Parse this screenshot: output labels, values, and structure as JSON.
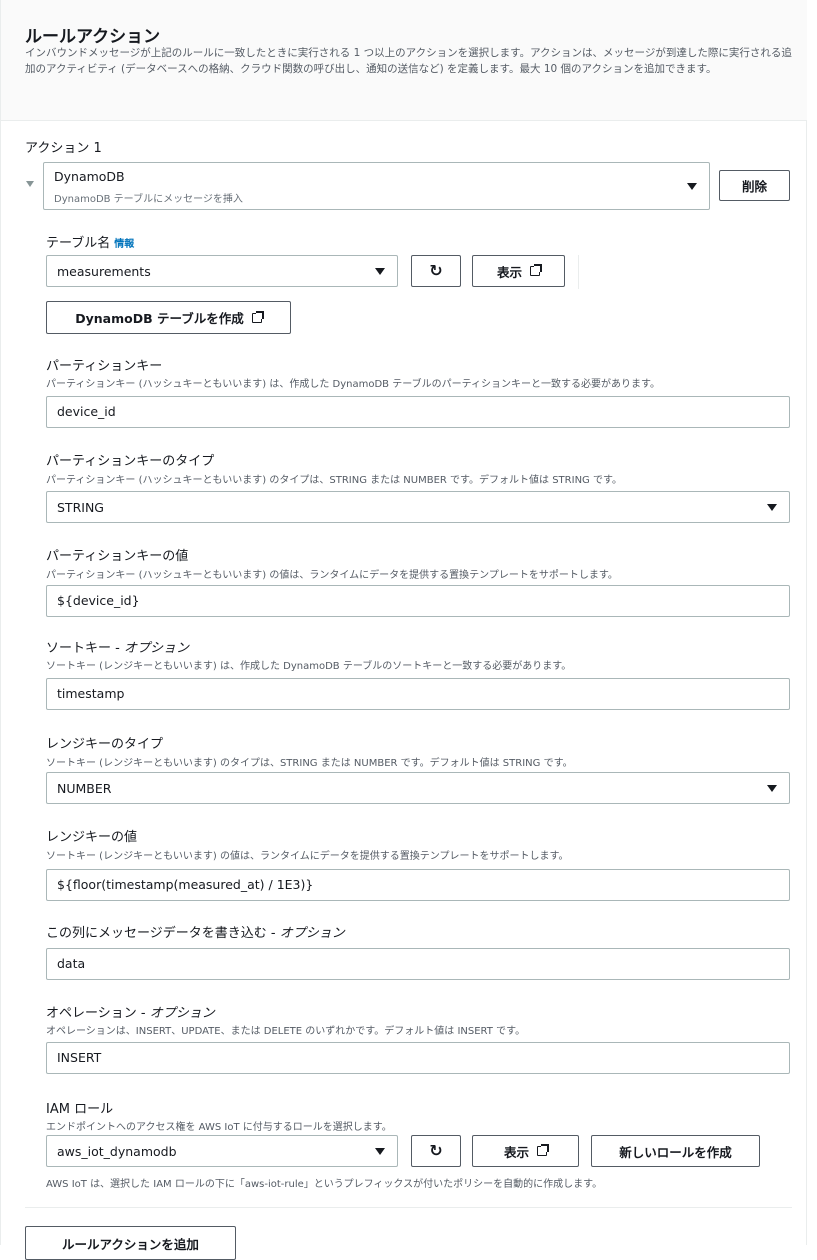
{
  "header": {
    "title": "ルールアクション",
    "description": "インバウンドメッセージが上記のルールに一致したときに実行される 1 つ以上のアクションを選択します。アクションは、メッセージが到達した際に実行される追加のアクティビティ (データベースへの格納、クラウド関数の呼び出し、通知の送信など) を定義します。最大 10 個のアクションを追加できます。"
  },
  "action": {
    "label": "アクション 1",
    "service": "DynamoDB",
    "service_desc": "DynamoDB テーブルにメッセージを挿入",
    "delete_label": "削除"
  },
  "table": {
    "label": "テーブル名",
    "info": "情報",
    "value": "measurements",
    "view_label": "表示",
    "create_label": "DynamoDB テーブルを作成"
  },
  "partition_key": {
    "label": "パーティションキー",
    "desc": "パーティションキー (ハッシュキーともいいます) は、作成した DynamoDB テーブルのパーティションキーと一致する必要があります。",
    "value": "device_id"
  },
  "partition_key_type": {
    "label": "パーティションキーのタイプ",
    "desc": "パーティションキー (ハッシュキーともいいます) のタイプは、STRING または NUMBER です。デフォルト値は STRING です。",
    "value": "STRING"
  },
  "partition_key_value": {
    "label": "パーティションキーの値",
    "desc": "パーティションキー (ハッシュキーともいいます) の値は、ランタイムにデータを提供する置換テンプレートをサポートします。",
    "value": "${device_id}"
  },
  "sort_key": {
    "label": "ソートキー - ",
    "label_opt": "オプション",
    "desc": "ソートキー (レンジキーともいいます) は、作成した DynamoDB テーブルのソートキーと一致する必要があります。",
    "value": "timestamp"
  },
  "range_key_type": {
    "label": "レンジキーのタイプ",
    "desc": "ソートキー (レンジキーともいいます) のタイプは、STRING または NUMBER です。デフォルト値は STRING です。",
    "value": "NUMBER"
  },
  "range_key_value": {
    "label": "レンジキーの値",
    "desc": "ソートキー (レンジキーともいいます) の値は、ランタイムにデータを提供する置換テンプレートをサポートします。",
    "value": "${floor(timestamp(measured_at) / 1E3)}"
  },
  "payload_column": {
    "label": "この列にメッセージデータを書き込む - ",
    "label_opt": "オプション",
    "value": "data"
  },
  "operation": {
    "label": "オペレーション - ",
    "label_opt": "オプション",
    "desc": "オペレーションは、INSERT、UPDATE、または DELETE のいずれかです。デフォルト値は INSERT です。",
    "value": "INSERT"
  },
  "iam_role": {
    "label": "IAM ロール",
    "desc": "エンドポイントへのアクセス権を AWS IoT に付与するロールを選択します。",
    "value": "aws_iot_dynamodb",
    "view_label": "表示",
    "create_label": "新しいロールを作成",
    "note": "AWS IoT は、選択した IAM ロールの下に「aws-iot-rule」というプレフィックスが付いたポリシーを自動的に作成します。"
  },
  "footer": {
    "add_action_label": "ルールアクションを追加"
  }
}
